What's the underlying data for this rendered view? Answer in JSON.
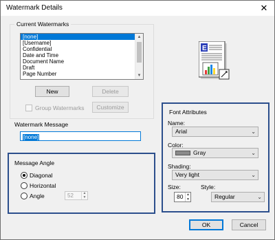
{
  "window": {
    "title": "Watermark Details",
    "close_glyph": "✕"
  },
  "current_watermarks": {
    "label": "Current Watermarks",
    "items": [
      "[none]",
      "[Username]",
      "Confidential",
      "Date and Time",
      "Document Name",
      "Draft",
      "Page Number"
    ],
    "selected_index": 0,
    "new_button": "New",
    "delete_button": "Delete",
    "group_checkbox": "Group Watermarks",
    "group_checked": false,
    "customize_button": "Customize"
  },
  "watermark_message": {
    "label": "Watermark Message",
    "value": "[none]"
  },
  "message_angle": {
    "label": "Message Angle",
    "options": [
      "Diagonal",
      "Horizontal",
      "Angle"
    ],
    "selected": "Diagonal",
    "angle_value": "52"
  },
  "font_attributes": {
    "label": "Font Attributes",
    "name_label": "Name:",
    "name_value": "Arial",
    "color_label": "Color:",
    "color_value": "Gray",
    "color_swatch": "#8a8a8a",
    "shading_label": "Shading:",
    "shading_value": "Very light",
    "size_label": "Size:",
    "size_value": "80",
    "style_label": "Style:",
    "style_value": "Regular"
  },
  "footer": {
    "ok_button": "OK",
    "cancel_button": "Cancel"
  },
  "colors": {
    "accent": "#0078d7",
    "highlight_border": "#2b4e8c"
  }
}
